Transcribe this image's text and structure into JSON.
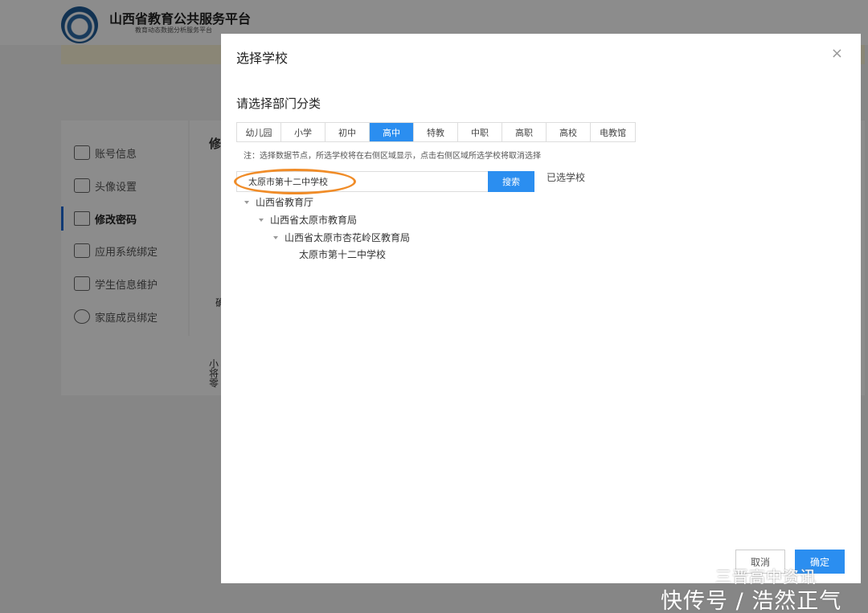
{
  "header": {
    "title": "山西省教育公共服务平台",
    "subtitle": "教育动态数据分析服务平台"
  },
  "sidebar": {
    "items": [
      {
        "label": "账号信息",
        "icon": "id-card-icon"
      },
      {
        "label": "头像设置",
        "icon": "avatar-icon"
      },
      {
        "label": "修改密码",
        "icon": "lock-icon"
      },
      {
        "label": "应用系统绑定",
        "icon": "grid-icon"
      },
      {
        "label": "学生信息维护",
        "icon": "cube-icon"
      },
      {
        "label": "家庭成员绑定",
        "icon": "chat-icon"
      }
    ],
    "active_index": 2
  },
  "background_fragments": {
    "main_heading": "修",
    "char_1": "确",
    "char_2": "小",
    "char_3": "将",
    "char_4": "零"
  },
  "modal": {
    "title": "选择学校",
    "close": "×",
    "section_title": "请选择部门分类",
    "tabs": [
      "幼儿园",
      "小学",
      "初中",
      "高中",
      "特教",
      "中职",
      "高职",
      "高校",
      "电教馆"
    ],
    "active_tab": "高中",
    "note": "注：选择数据节点，所选学校将在右侧区域显示，点击右侧区域所选学校将取消选择",
    "search": {
      "value": "太原市第十二中学校",
      "button": "搜索"
    },
    "selected_label": "已选学校",
    "tree": [
      {
        "label": "山西省教育厅",
        "level": 0,
        "expanded": true
      },
      {
        "label": "山西省太原市教育局",
        "level": 1,
        "expanded": true
      },
      {
        "label": "山西省太原市杏花岭区教育局",
        "level": 2,
        "expanded": true
      },
      {
        "label": "太原市第十二中学校",
        "level": 3,
        "expanded": false
      }
    ],
    "cancel": "取消",
    "ok": "确定"
  },
  "watermark": {
    "line1": "三晋高中资讯",
    "line2": "快传号 / 浩然正气"
  },
  "colors": {
    "accent": "#2b8ef0",
    "highlight_ring": "#f08c28"
  }
}
